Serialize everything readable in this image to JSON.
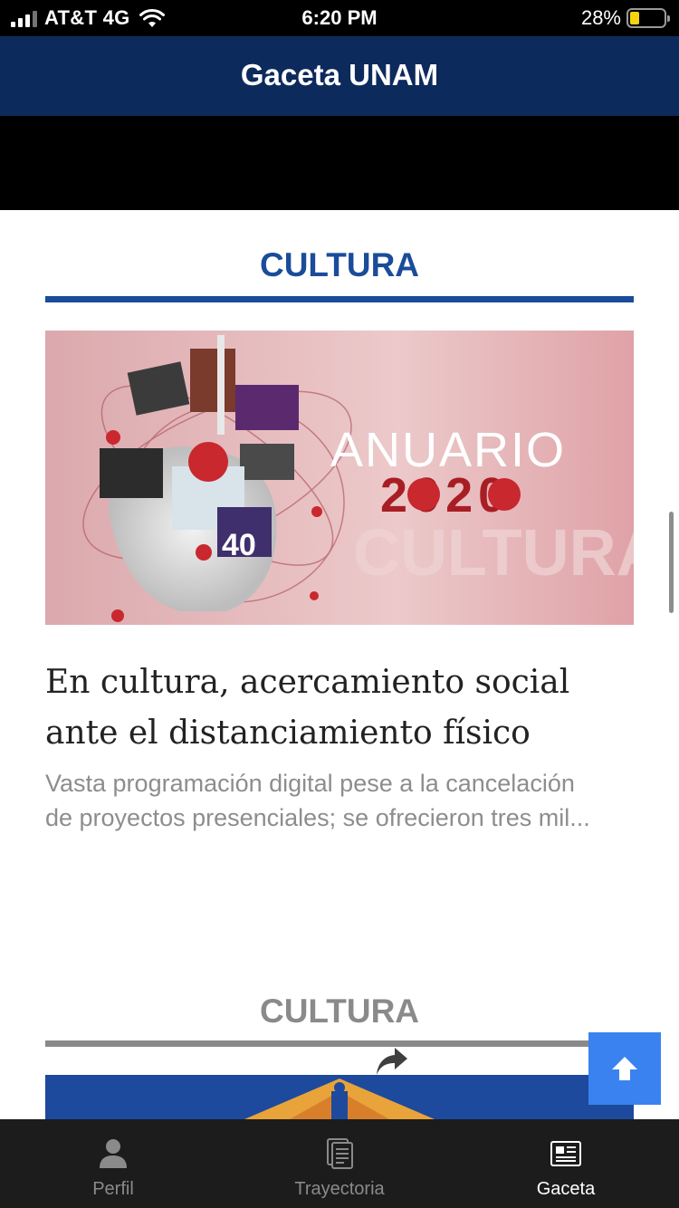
{
  "status_bar": {
    "carrier": "AT&T 4G",
    "time": "6:20 PM",
    "battery_percent": "28%",
    "battery_level": 0.28,
    "battery_color": "#f5d40f"
  },
  "header": {
    "title": "Gaceta UNAM",
    "color": "#0d2a5c"
  },
  "sections": [
    {
      "title": "CULTURA",
      "accent": "#1a4c9a",
      "article": {
        "image": {
          "alt_text_lines": [
            "ANUARIO",
            "2020",
            "CULTURA"
          ],
          "badge": "40"
        },
        "headline": "En cultura, acercamiento social ante el distanciamiento físico",
        "excerpt": "Vasta programación digital pese a la cancelación de proyectos presenciales; se ofrecieron tres mil..."
      }
    },
    {
      "title": "CULTURA",
      "accent": "#8a8a8a"
    }
  ],
  "icons": {
    "share": "share-icon",
    "scroll_top": "arrow-up-icon"
  },
  "tab_bar": {
    "tabs": [
      {
        "label": "Perfil",
        "icon": "person-icon",
        "active": false
      },
      {
        "label": "Trayectoria",
        "icon": "document-icon",
        "active": false
      },
      {
        "label": "Gaceta",
        "icon": "newspaper-icon",
        "active": true
      }
    ]
  }
}
